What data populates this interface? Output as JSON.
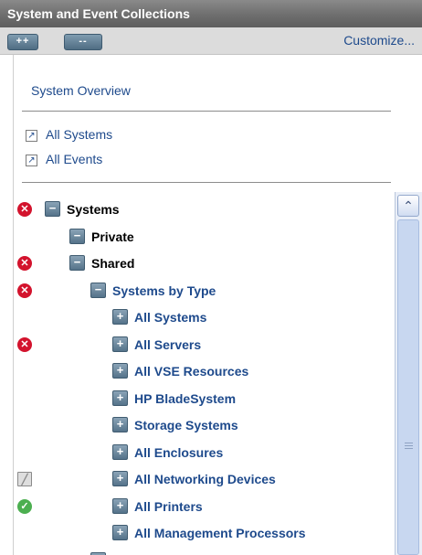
{
  "panel": {
    "title": "System and Event Collections",
    "expand_all_label": "++",
    "collapse_all_label": "--",
    "customize_label": "Customize..."
  },
  "links": {
    "system_overview": "System Overview",
    "all_systems": "All Systems",
    "all_events": "All Events",
    "external_icon_glyph": "↗"
  },
  "tree": {
    "nodes": [
      {
        "label": "Systems",
        "toggle": "−",
        "status": "error"
      },
      {
        "label": "Private",
        "toggle": "−",
        "status": ""
      },
      {
        "label": "Shared",
        "toggle": "−",
        "status": "error"
      },
      {
        "label": "Systems by Type",
        "toggle": "−",
        "status": "error"
      },
      {
        "label": "All Systems",
        "toggle": "+",
        "status": ""
      },
      {
        "label": "All Servers",
        "toggle": "+",
        "status": "error"
      },
      {
        "label": "All VSE Resources",
        "toggle": "+",
        "status": ""
      },
      {
        "label": "HP BladeSystem",
        "toggle": "+",
        "status": ""
      },
      {
        "label": "Storage Systems",
        "toggle": "+",
        "status": ""
      },
      {
        "label": "All Enclosures",
        "toggle": "+",
        "status": ""
      },
      {
        "label": "All Networking Devices",
        "toggle": "+",
        "status": "unknown"
      },
      {
        "label": "All Printers",
        "toggle": "+",
        "status": "ok"
      },
      {
        "label": "All Management Processors",
        "toggle": "+",
        "status": ""
      }
    ]
  },
  "status_glyphs": {
    "error": "✕",
    "ok": "✓",
    "unknown": "╱"
  },
  "scrollbar": {
    "up_glyph": "⌃"
  },
  "colors": {
    "link": "#1e4a8c",
    "error": "#d3132d",
    "ok": "#4caf50"
  }
}
